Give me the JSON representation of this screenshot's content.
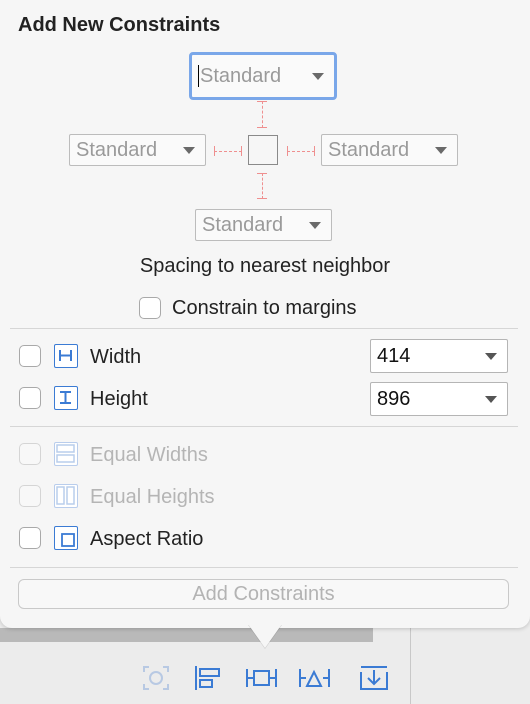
{
  "popover": {
    "title": "Add New Constraints",
    "spacing": {
      "top_value": "Standard",
      "left_value": "Standard",
      "right_value": "Standard",
      "bottom_value": "Standard",
      "description": "Spacing to nearest neighbor"
    },
    "constrain_to_margins": {
      "label": "Constrain to margins",
      "checked": false
    },
    "width": {
      "label": "Width",
      "value": "414",
      "checked": false
    },
    "height": {
      "label": "Height",
      "value": "896",
      "checked": false
    },
    "equal_widths": {
      "label": "Equal Widths",
      "enabled": false
    },
    "equal_heights": {
      "label": "Equal Heights",
      "enabled": false
    },
    "aspect_ratio": {
      "label": "Aspect Ratio",
      "checked": false
    },
    "add_button": {
      "label": "Add Constraints",
      "enabled": false
    }
  },
  "toolbar": {
    "icons": [
      "update-frames-icon",
      "align-icon",
      "add-constraints-icon",
      "resolve-issues-icon",
      "embed-in-icon"
    ]
  },
  "colors": {
    "accent": "#3b7bd4",
    "guide": "#ef8f8f",
    "focus_ring": "#7aa7e9"
  }
}
